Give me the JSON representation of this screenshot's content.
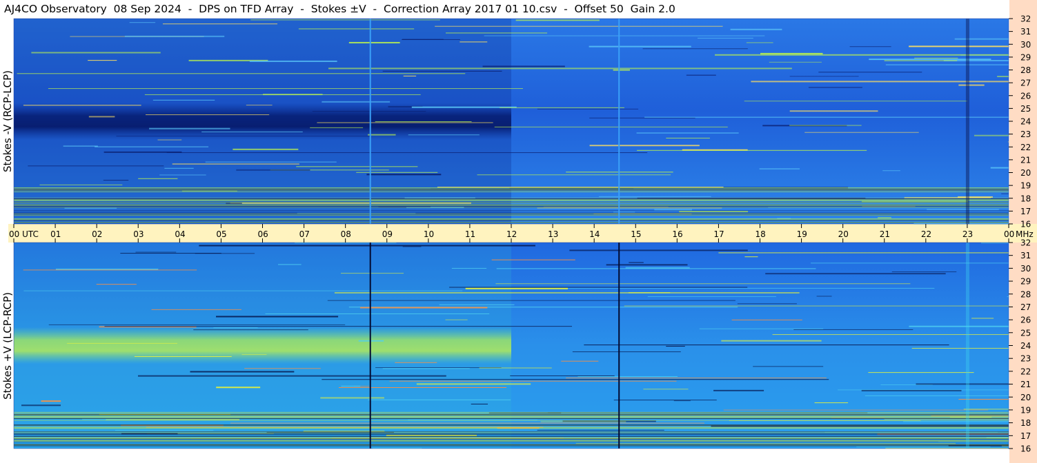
{
  "title": "AJ4CO Observatory  08 Sep 2024  -  DPS on TFD Array  -  Stokes ±V  -  Correction Array 2017 01 10.csv  -  Offset 50  Gain 2.0",
  "chart_data": [
    {
      "type": "heatmap",
      "panel": "top",
      "ylabel": "Stokes -V (RCP-LCP)",
      "x_ticks": [
        "00  UTC",
        "01",
        "02",
        "03",
        "04",
        "05",
        "06",
        "07",
        "08",
        "09",
        "10",
        "11",
        "12",
        "13",
        "14",
        "15",
        "16",
        "17",
        "18",
        "19",
        "20",
        "21",
        "22",
        "23",
        "00"
      ],
      "x_unit": "MHz",
      "y_ticks": [
        32,
        31,
        30,
        29,
        28,
        27,
        26,
        25,
        24,
        23,
        22,
        21,
        20,
        19,
        18,
        17,
        16
      ],
      "xlim": [
        0,
        24
      ],
      "ylim": [
        16,
        32
      ],
      "grid": false,
      "colors": {
        "dark": "#051a66",
        "mid": "#1d4fd8",
        "light": "#2c86e8",
        "hot": "#c8f040"
      },
      "features": {
        "dark_band_mhz": [
          23,
          25
        ],
        "dark_band_hours": [
          0,
          12
        ],
        "vertical_lines_hours": [
          8.6,
          14.6
        ],
        "bright_column_hours": [
          23
        ]
      }
    },
    {
      "type": "heatmap",
      "panel": "bottom",
      "ylabel": "Stokes +V  (LCP-RCP)",
      "x_ticks": [
        "00  UTC",
        "01",
        "02",
        "03",
        "04",
        "05",
        "06",
        "07",
        "08",
        "09",
        "10",
        "11",
        "12",
        "13",
        "14",
        "15",
        "16",
        "17",
        "18",
        "19",
        "20",
        "21",
        "22",
        "23",
        "00"
      ],
      "x_unit": "MHz",
      "y_ticks": [
        32,
        31,
        30,
        29,
        28,
        27,
        26,
        25,
        24,
        23,
        22,
        21,
        20,
        19,
        18,
        17,
        16
      ],
      "xlim": [
        0,
        24
      ],
      "ylim": [
        16,
        32
      ],
      "grid": false,
      "colors": {
        "dark": "#041040",
        "mid": "#1e6fe0",
        "light": "#2fb0f0",
        "hot": "#d8ec40"
      },
      "features": {
        "bright_band_mhz": [
          23,
          25
        ],
        "bright_band_hours": [
          0,
          12
        ],
        "vertical_lines_hours": [
          8.6,
          14.6
        ]
      }
    }
  ]
}
